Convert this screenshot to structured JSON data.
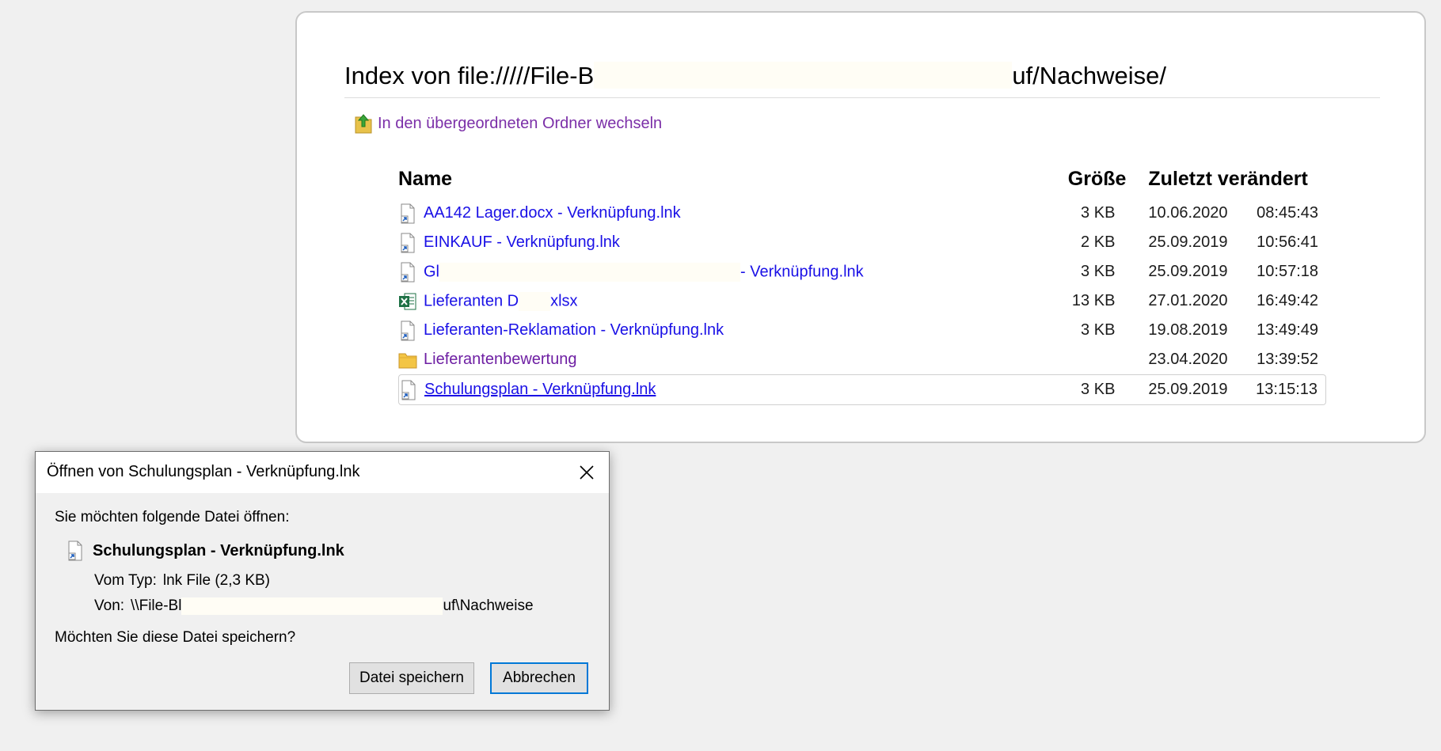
{
  "listing": {
    "title_start": "Index von file://///File-B",
    "title_end": "uf/Nachweise/",
    "up_link": "In den übergeordneten Ordner wechseln",
    "headers": {
      "name": "Name",
      "size": "Größe",
      "modified": "Zuletzt verändert"
    },
    "rows": [
      {
        "name": "AA142 Lager.docx - Verknüpfung.lnk",
        "size": "3 KB",
        "date": "10.06.2020",
        "time": "08:45:43",
        "icon": "shortcut-file-icon"
      },
      {
        "name": "EINKAUF - Verknüpfung.lnk",
        "size": "2 KB",
        "date": "25.09.2019",
        "time": "10:56:41",
        "icon": "shortcut-file-icon"
      },
      {
        "name_start": "Gl",
        "name_end": "- Verknüpfung.lnk",
        "size": "3 KB",
        "date": "25.09.2019",
        "time": "10:57:18",
        "icon": "shortcut-file-icon"
      },
      {
        "name_start": "Lieferanten D",
        "name_end": "xlsx",
        "size": "13 KB",
        "date": "27.01.2020",
        "time": "16:49:42",
        "icon": "excel-file-icon"
      },
      {
        "name": "Lieferanten-Reklamation - Verknüpfung.lnk",
        "size": "3 KB",
        "date": "19.08.2019",
        "time": "13:49:49",
        "icon": "shortcut-file-icon"
      },
      {
        "name": "Lieferantenbewertung",
        "size": "",
        "date": "23.04.2020",
        "time": "13:39:52",
        "icon": "folder-icon"
      },
      {
        "name": "Schulungsplan - Verknüpfung.lnk",
        "size": "3 KB",
        "date": "25.09.2019",
        "time": "13:15:13",
        "icon": "shortcut-file-icon"
      }
    ]
  },
  "dialog": {
    "title": "Öffnen von Schulungsplan - Verknüpfung.lnk",
    "prompt": "Sie möchten folgende Datei öffnen:",
    "file_name": "Schulungsplan - Verknüpfung.lnk",
    "type_label": "Vom Typ:",
    "type_value": "lnk File (2,3 KB)",
    "from_label": "Von:",
    "from_start": "\\\\File-Bl",
    "from_end": "uf\\Nachweise",
    "question": "Möchten Sie diese Datei speichern?",
    "save_button": "Datei speichern",
    "cancel_button": "Abbrechen"
  }
}
